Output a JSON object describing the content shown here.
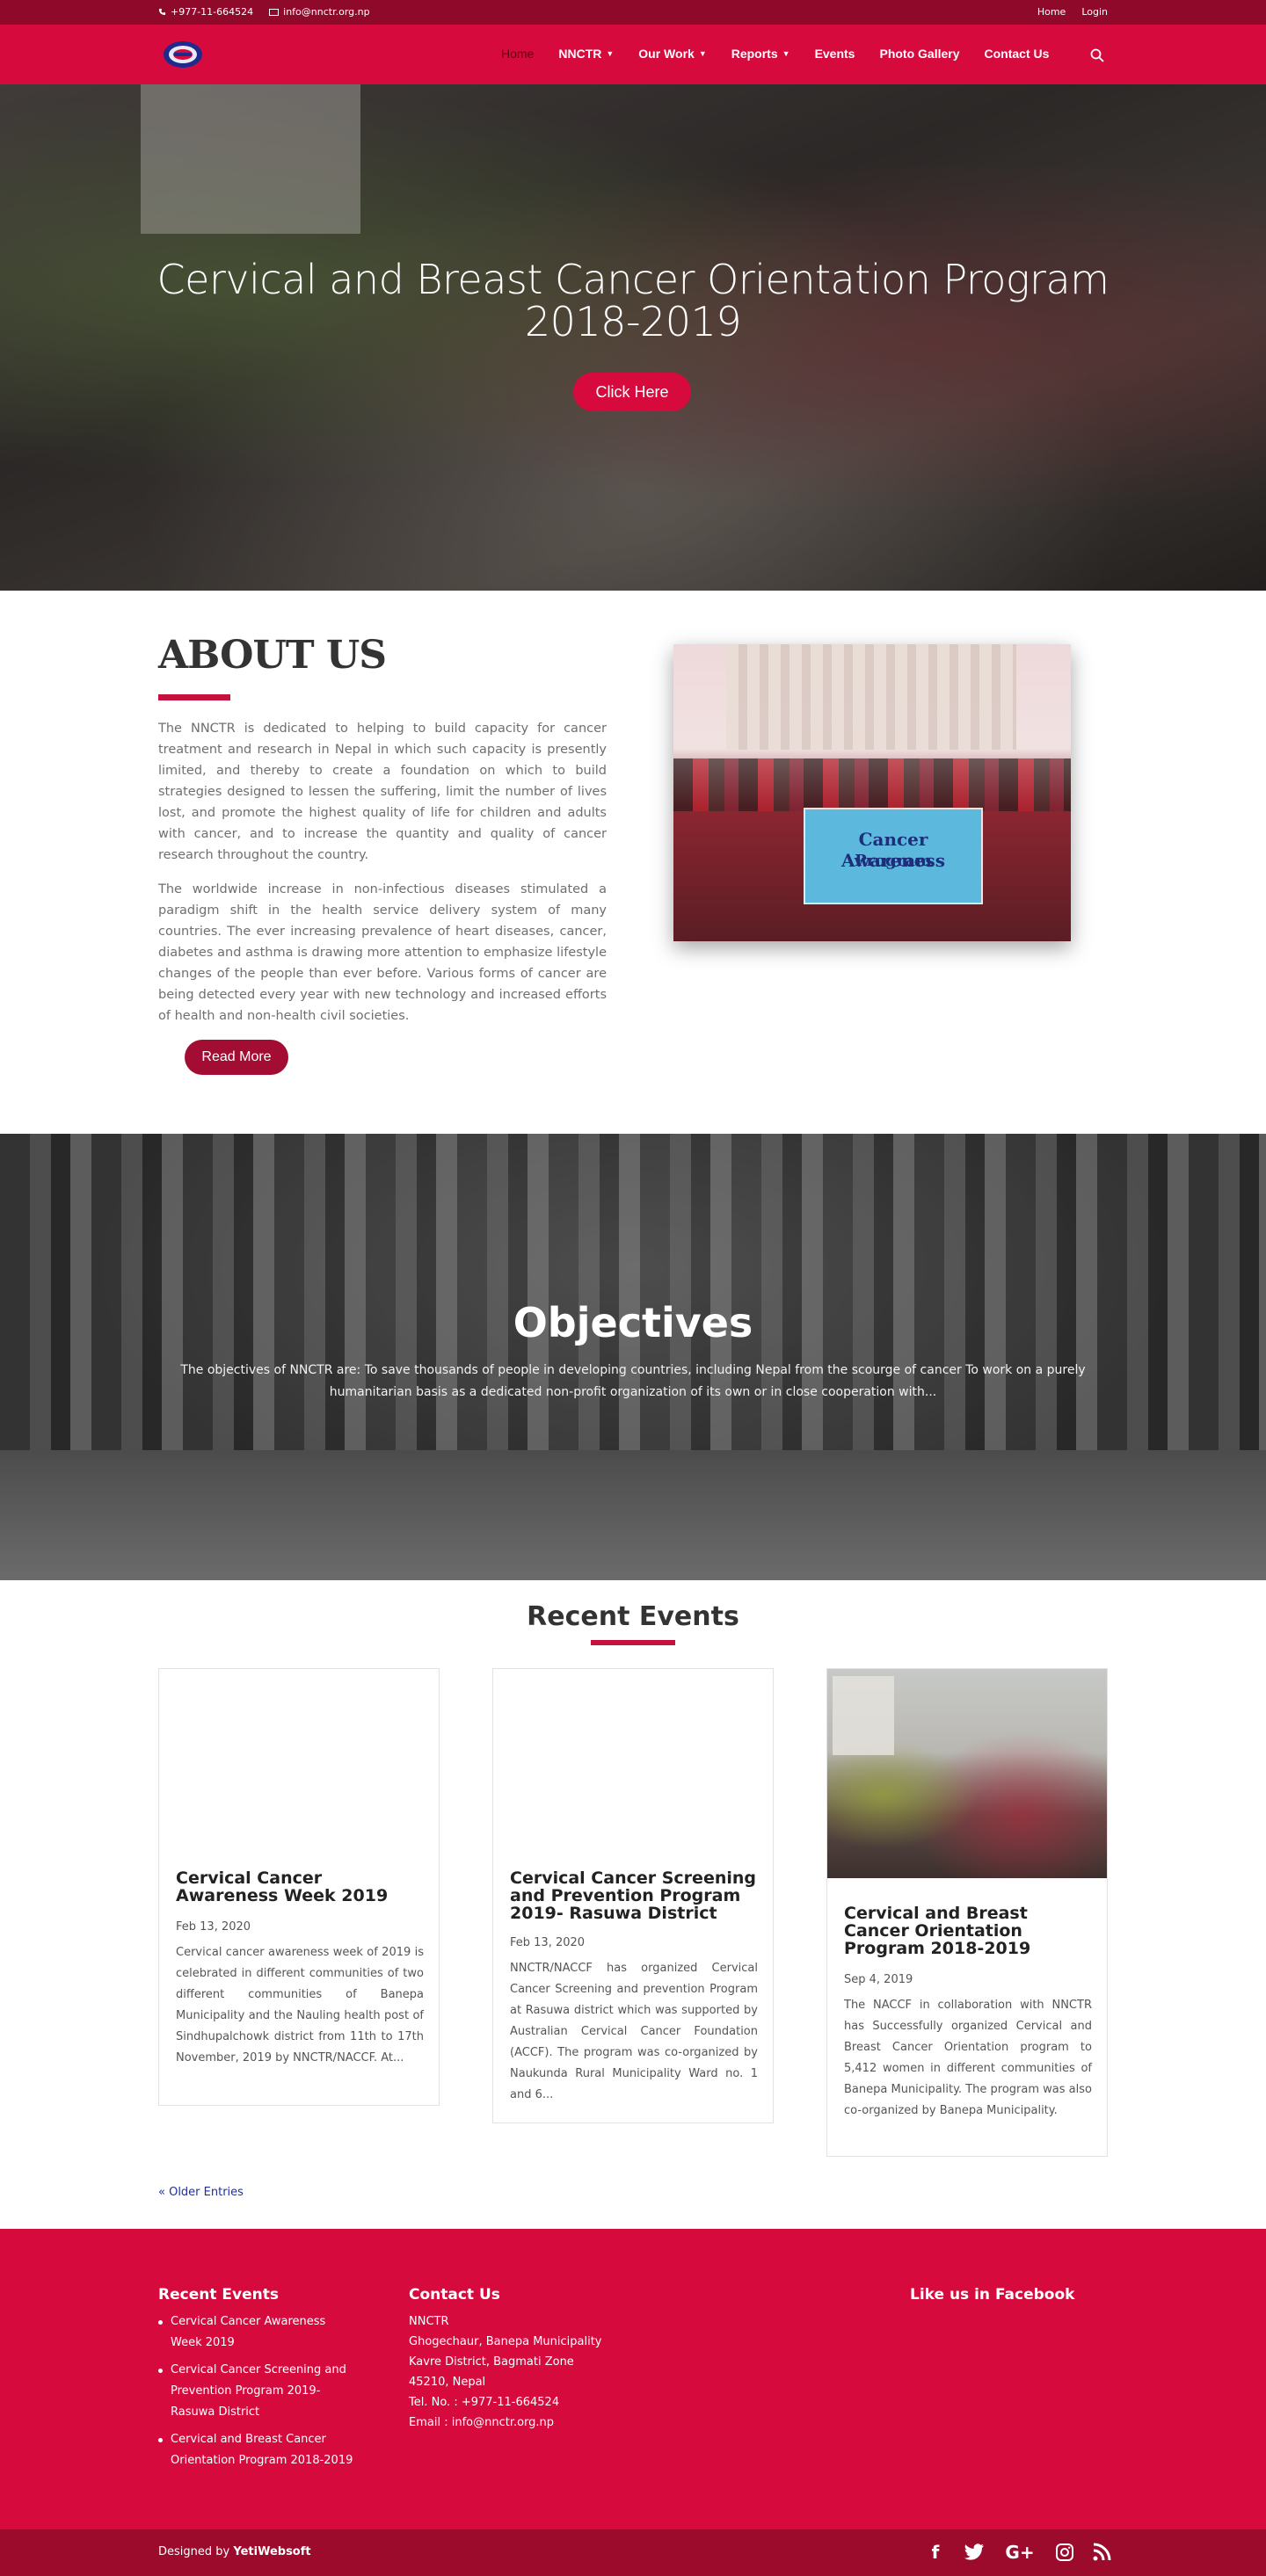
{
  "topbar": {
    "phone": "+977-11-664524",
    "email": "info@nnctr.org.np",
    "links": [
      "Home",
      "Login"
    ]
  },
  "nav": {
    "items": [
      {
        "label": "Home",
        "active": true,
        "has_dropdown": false
      },
      {
        "label": "NNCTR",
        "active": false,
        "has_dropdown": true
      },
      {
        "label": "Our Work",
        "active": false,
        "has_dropdown": true
      },
      {
        "label": "Reports",
        "active": false,
        "has_dropdown": true
      },
      {
        "label": "Events",
        "active": false,
        "has_dropdown": false
      },
      {
        "label": "Photo Gallery",
        "active": false,
        "has_dropdown": false
      },
      {
        "label": "Contact Us",
        "active": false,
        "has_dropdown": false
      }
    ],
    "search_icon": "search-icon"
  },
  "hero": {
    "title_line1": "Cervical and Breast Cancer Orientation Program",
    "title_line2": "2018-2019",
    "button": "Click Here",
    "slides": 2,
    "active_slide": 1
  },
  "about": {
    "heading": "ABOUT US",
    "paragraph1": "The NNCTR is dedicated to helping to build capacity for cancer treatment and research in Nepal in which such capacity is presently limited, and thereby to create a foundation on which to build strategies designed to lessen the suffering, limit the number of lives lost, and promote the highest quality of life for children and adults with cancer, and to increase the quantity and quality of cancer research throughout the country.",
    "paragraph2": "The worldwide increase in non-infectious diseases stimulated a paradigm shift in the health service delivery system of many countries. The ever increasing prevalence of heart diseases, cancer, diabetes and asthma is drawing more attention to emphasize lifestyle changes of the people than ever before. Various forms of cancer are being detected every year with new technology and increased efforts of health and non-health civil societies.",
    "button": "Read More",
    "photo_banner_line1": "Cancer Awareness",
    "photo_banner_line2": "Program"
  },
  "objectives": {
    "heading": "Objectives",
    "text": "The objectives of NNCTR are: To save thousands of people in developing countries, including Nepal from the scourge of cancer To work on a purely humanitarian basis as a dedicated non-profit organization of its own or in close cooperation with..."
  },
  "events": {
    "heading": "Recent Events",
    "cards": [
      {
        "title": "Cervical Cancer Awareness Week 2019",
        "date": "Feb 13, 2020",
        "text": "Cervical cancer awareness week of 2019 is celebrated in different communities of two different communities of Banepa Municipality and the Nauling health post of Sindhupalchowk district from 11th to 17th November, 2019 by NNCTR/NACCF. At..."
      },
      {
        "title": "Cervical Cancer Screening and Prevention Program 2019- Rasuwa District",
        "date": "Feb 13, 2020",
        "text": "NNCTR/NACCF has organized Cervical Cancer Screening and prevention Program at Rasuwa district which was supported by Australian Cervical Cancer Foundation (ACCF). The program was co-organized by Naukunda Rural Municipality Ward no. 1 and 6..."
      },
      {
        "title": "Cervical and Breast Cancer Orientation Program 2018-2019",
        "date": "Sep 4, 2019",
        "text": "The NACCF in collaboration with NNCTR has Successfully organized Cervical and Breast Cancer Orientation program to 5,412 women in different communities of Banepa Municipality. The program was also co-organized by Banepa Municipality."
      }
    ],
    "older_entries": "« Older Entries"
  },
  "footer": {
    "recent_heading": "Recent Events",
    "recent_items": [
      "Cervical Cancer Awareness Week 2019",
      "Cervical Cancer Screening and Prevention Program 2019- Rasuwa District",
      "Cervical and Breast Cancer Orientation Program 2018-2019"
    ],
    "contact_heading": "Contact Us",
    "contact_lines": [
      "NNCTR",
      "Ghogechaur, Banepa Municipality",
      "Kavre District, Bagmati Zone",
      "45210, Nepal",
      "Tel. No. : +977-11-664524",
      "Email : info@nnctr.org.np"
    ],
    "facebook_heading": "Like us in Facebook",
    "credit_prefix": "Designed by",
    "credit_name": "YetiWebsoft",
    "social_icons": [
      "facebook-icon",
      "twitter-icon",
      "google-plus-icon",
      "instagram-icon",
      "rss-icon"
    ]
  },
  "colors": {
    "brand_red": "#d60a3d",
    "dark_red": "#8f0a2a",
    "button_red": "#a30d34"
  }
}
